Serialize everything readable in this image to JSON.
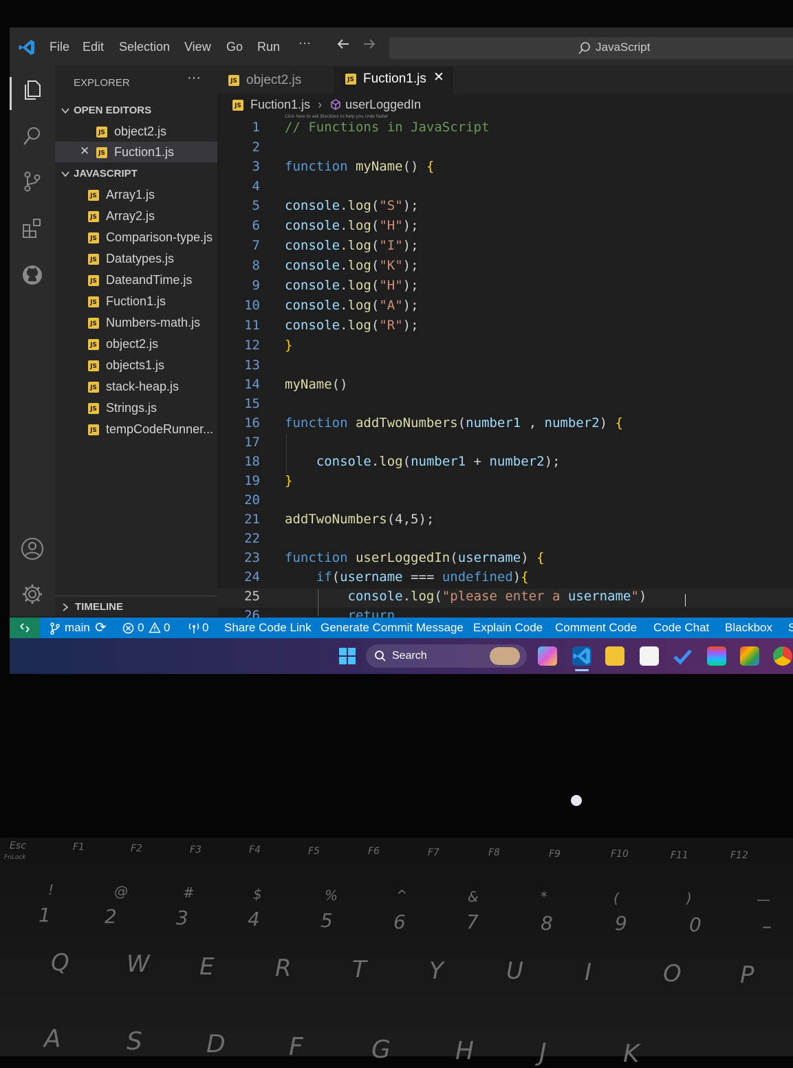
{
  "titlebar": {
    "menu": [
      "File",
      "Edit",
      "Selection",
      "View",
      "Go",
      "Run",
      "···"
    ],
    "search_text": "JavaScript"
  },
  "sidebar": {
    "title": "EXPLORER",
    "more": "···",
    "open_editors_label": "OPEN EDITORS",
    "open_editors": [
      "object2.js",
      "Fuction1.js"
    ],
    "folder_label": "JAVASCRIPT",
    "files": [
      "Array1.js",
      "Array2.js",
      "Comparison-type.js",
      "Datatypes.js",
      "DateandTime.js",
      "Fuction1.js",
      "Numbers-math.js",
      "object2.js",
      "objects1.js",
      "stack-heap.js",
      "Strings.js",
      "tempCodeRunner..."
    ],
    "timeline_label": "TIMELINE",
    "js_badge": "JS"
  },
  "tabs": {
    "tab1": "object2.js",
    "tab2": "Fuction1.js",
    "close": "✕"
  },
  "breadcrumb": {
    "file": "Fuction1.js",
    "symbol": "userLoggedIn",
    "hint": "Click here to ask Blackbox to help you code faster"
  },
  "code": {
    "lines": [
      {
        "n": "1",
        "t": "// Functions in JavaScript"
      },
      {
        "n": "2",
        "t": ""
      },
      {
        "n": "3",
        "t": "function myName() {"
      },
      {
        "n": "4",
        "t": ""
      },
      {
        "n": "5",
        "t": "console.log(\"S\");"
      },
      {
        "n": "6",
        "t": "console.log(\"H\");"
      },
      {
        "n": "7",
        "t": "console.log(\"I\");"
      },
      {
        "n": "8",
        "t": "console.log(\"K\");"
      },
      {
        "n": "9",
        "t": "console.log(\"H\");"
      },
      {
        "n": "10",
        "t": "console.log(\"A\");"
      },
      {
        "n": "11",
        "t": "console.log(\"R\");"
      },
      {
        "n": "12",
        "t": "}"
      },
      {
        "n": "13",
        "t": ""
      },
      {
        "n": "14",
        "t": "myName()"
      },
      {
        "n": "15",
        "t": ""
      },
      {
        "n": "16",
        "t": "function addTwoNumbers(number1 , number2) {"
      },
      {
        "n": "17",
        "t": ""
      },
      {
        "n": "18",
        "t": "    console.log(number1 + number2);"
      },
      {
        "n": "19",
        "t": "}"
      },
      {
        "n": "20",
        "t": ""
      },
      {
        "n": "21",
        "t": "addTwoNumbers(4,5);"
      },
      {
        "n": "22",
        "t": ""
      },
      {
        "n": "23",
        "t": "function userLoggedIn(username) {"
      },
      {
        "n": "24",
        "t": "    if(username === undefined){"
      },
      {
        "n": "25",
        "t": "        console.log(\"please enter a username\")"
      },
      {
        "n": "26",
        "t": "        return"
      }
    ]
  },
  "statusbar": {
    "branch": "main",
    "sync": "⟳",
    "errors": "0",
    "warnings": "0",
    "ports": "0",
    "actions": [
      "Share Code Link",
      "Generate Commit Message",
      "Explain Code",
      "Comment Code",
      "Code Chat",
      "Blackbox",
      "S"
    ]
  },
  "taskbar": {
    "search_label": "Search"
  },
  "keyboard": {
    "fn_row": [
      "Esc",
      "F1",
      "F2",
      "F3",
      "F4",
      "F5",
      "F6",
      "F7",
      "F8",
      "F9",
      "F10",
      "F11",
      "F12"
    ],
    "fn_lock": "FnLock",
    "num_symbols": [
      "!",
      "@",
      "#",
      "$",
      "%",
      "^",
      "&",
      "*",
      "(",
      ")",
      "—"
    ],
    "num_row": [
      "1",
      "2",
      "3",
      "4",
      "5",
      "6",
      "7",
      "8",
      "9",
      "0",
      "–"
    ],
    "qwerty_row": [
      "Q",
      "W",
      "E",
      "R",
      "T",
      "Y",
      "U",
      "I",
      "O",
      "P"
    ],
    "home_row": [
      "A",
      "S",
      "D",
      "F",
      "G",
      "H",
      "J",
      "K"
    ]
  },
  "colors": {
    "accent": "#007acc",
    "js_badge": "#e8c046"
  }
}
